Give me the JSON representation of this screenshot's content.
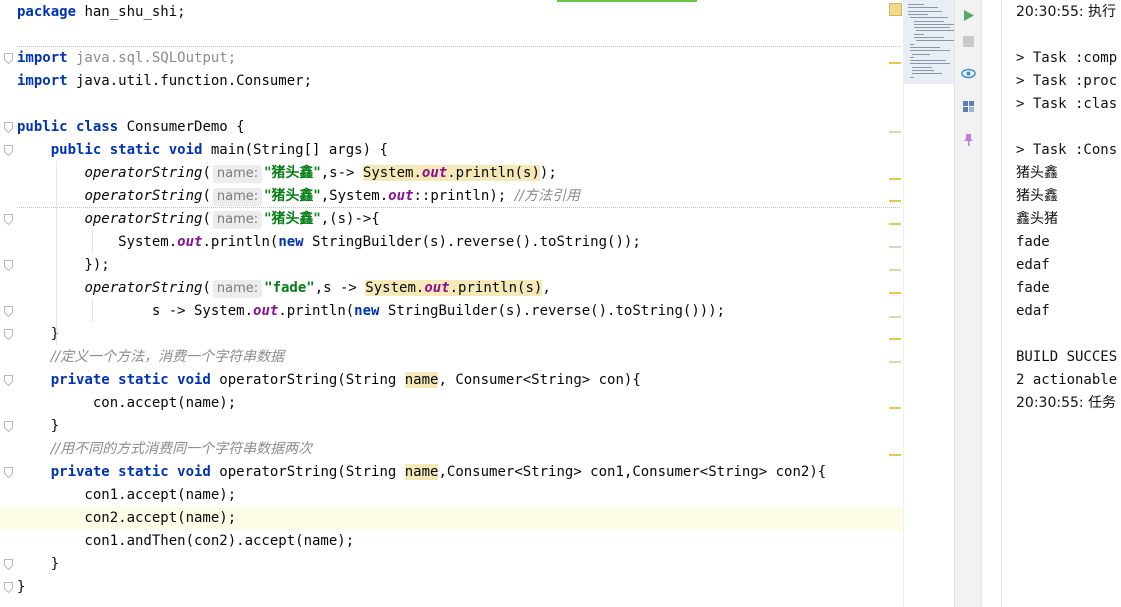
{
  "editor": {
    "lines": [
      {
        "segs": [
          {
            "t": "package",
            "c": "kw"
          },
          {
            "t": " han_shu_shi;"
          }
        ]
      },
      {
        "segs": []
      },
      {
        "segs": [
          {
            "t": "import",
            "c": "kw"
          },
          {
            "t": " java.sql.SQLOutput;",
            "c": "gray"
          }
        ]
      },
      {
        "segs": [
          {
            "t": "import",
            "c": "kw"
          },
          {
            "t": " java.util.function.Consumer;"
          }
        ]
      },
      {
        "segs": []
      },
      {
        "segs": [
          {
            "t": "public class",
            "c": "kw"
          },
          {
            "t": " ConsumerDemo {"
          }
        ]
      },
      {
        "segs": [
          {
            "t": "    "
          },
          {
            "t": "public static void",
            "c": "kw"
          },
          {
            "t": " main(String[] args) {"
          }
        ]
      },
      {
        "segs": [
          {
            "t": "        "
          },
          {
            "t": "operatorString",
            "c": "it"
          },
          {
            "t": "("
          },
          {
            "t": "name:",
            "c": "hint"
          },
          {
            "t": "\"猪头鑫\"",
            "c": "str cjk"
          },
          {
            "t": ",s-> "
          },
          {
            "t": "System.",
            "c": "hl"
          },
          {
            "t": "out",
            "c": "fld hl"
          },
          {
            "t": ".println(s)",
            "c": "hl"
          },
          {
            "t": ");"
          }
        ]
      },
      {
        "segs": [
          {
            "t": "        "
          },
          {
            "t": "operatorString",
            "c": "it"
          },
          {
            "t": "("
          },
          {
            "t": "name:",
            "c": "hint"
          },
          {
            "t": "\"猪头鑫\"",
            "c": "str cjk"
          },
          {
            "t": ",System."
          },
          {
            "t": "out",
            "c": "fld"
          },
          {
            "t": "::println); "
          },
          {
            "t": "//方法引用",
            "c": "cmt cjk"
          }
        ]
      },
      {
        "segs": [
          {
            "t": "        "
          },
          {
            "t": "operatorString",
            "c": "it"
          },
          {
            "t": "("
          },
          {
            "t": "name:",
            "c": "hint"
          },
          {
            "t": "\"猪头鑫\"",
            "c": "str cjk"
          },
          {
            "t": ",(s)->{"
          }
        ]
      },
      {
        "segs": [
          {
            "t": "            System."
          },
          {
            "t": "out",
            "c": "fld"
          },
          {
            "t": ".println("
          },
          {
            "t": "new",
            "c": "kw"
          },
          {
            "t": " StringBuilder(s).reverse().toString());"
          }
        ]
      },
      {
        "segs": [
          {
            "t": "        });"
          }
        ]
      },
      {
        "segs": [
          {
            "t": "        "
          },
          {
            "t": "operatorString",
            "c": "it"
          },
          {
            "t": "("
          },
          {
            "t": "name:",
            "c": "hint"
          },
          {
            "t": "\"fade\"",
            "c": "str"
          },
          {
            "t": ",s -> "
          },
          {
            "t": "System.",
            "c": "hl"
          },
          {
            "t": "out",
            "c": "fld hl"
          },
          {
            "t": ".println(s)",
            "c": "hl"
          },
          {
            "t": ","
          }
        ]
      },
      {
        "segs": [
          {
            "t": "                s -> System."
          },
          {
            "t": "out",
            "c": "fld"
          },
          {
            "t": ".println("
          },
          {
            "t": "new",
            "c": "kw"
          },
          {
            "t": " StringBuilder(s).reverse().toString()));"
          }
        ]
      },
      {
        "segs": [
          {
            "t": "    }"
          }
        ]
      },
      {
        "segs": [
          {
            "t": "    "
          },
          {
            "t": "//定义一个方法，消费一个字符串数据",
            "c": "cmt cjk"
          }
        ]
      },
      {
        "segs": [
          {
            "t": "    "
          },
          {
            "t": "private static void",
            "c": "kw"
          },
          {
            "t": " operatorString(String "
          },
          {
            "t": "name",
            "c": "hl"
          },
          {
            "t": ", Consumer<String> con){"
          }
        ]
      },
      {
        "segs": [
          {
            "t": "         con.accept(name);"
          }
        ]
      },
      {
        "segs": [
          {
            "t": "    }"
          }
        ]
      },
      {
        "segs": [
          {
            "t": "    "
          },
          {
            "t": "//用不同的方式消费同一个字符串数据两次",
            "c": "cmt cjk"
          }
        ]
      },
      {
        "segs": [
          {
            "t": "    "
          },
          {
            "t": "private static void",
            "c": "kw"
          },
          {
            "t": " operatorString(String "
          },
          {
            "t": "name",
            "c": "hl"
          },
          {
            "t": ",Consumer<String> con1,Consumer<String> con2){"
          }
        ]
      },
      {
        "segs": [
          {
            "t": "        con1.accept(name);"
          }
        ]
      },
      {
        "segs": [
          {
            "t": "        con2.accept(name);"
          }
        ]
      },
      {
        "segs": [
          {
            "t": "        con1.andThen(con2).accept(name);"
          }
        ]
      },
      {
        "segs": [
          {
            "t": "    }"
          }
        ]
      },
      {
        "segs": [
          {
            "t": "}"
          }
        ]
      }
    ],
    "caret_line": 22
  },
  "console": {
    "lines": [
      "20:30:55: 执行",
      "",
      "> Task :comp",
      "> Task :proc",
      "> Task :clas",
      "",
      "> Task :Cons",
      "猪头鑫",
      "猪头鑫",
      "鑫头猪",
      "fade",
      "edaf",
      "fade",
      "edaf",
      "",
      "BUILD SUCCES",
      "2 actionable",
      "20:30:55: 任务"
    ]
  },
  "toolbar": {
    "run_icon": "run-icon",
    "stop_icon": "stop-icon",
    "view_icon": "eye-icon",
    "layout_icon": "layout-icon",
    "pin_icon": "pin-icon"
  },
  "colors": {
    "keyword": "#0033b3",
    "string": "#067d17",
    "field": "#871094",
    "comment": "#8c8c8c",
    "highlight": "#f5eab7",
    "caret_line": "#fefbe6",
    "run": "#59a869"
  }
}
